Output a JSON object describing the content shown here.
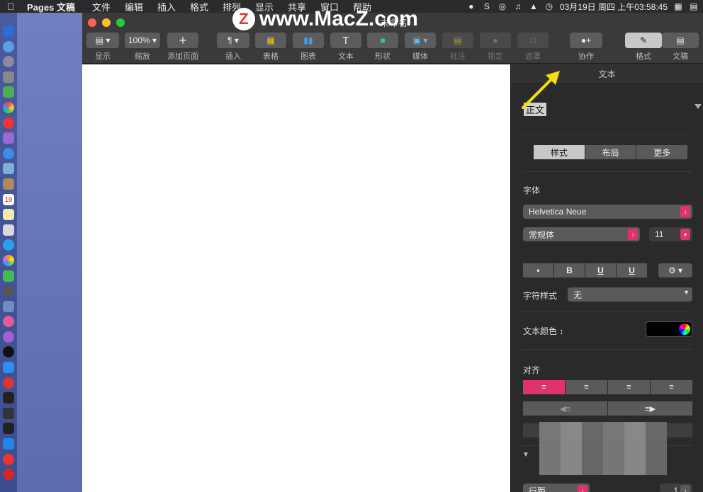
{
  "menubar": {
    "app_name": "Pages 文稿",
    "menus": [
      "文件",
      "编辑",
      "插入",
      "格式",
      "排列",
      "显示",
      "共享",
      "窗口",
      "帮助"
    ],
    "clock": "03月19日 周四 上午03:58:45"
  },
  "window": {
    "title": "未命名",
    "toolbar": {
      "view": "显示",
      "zoom_value": "100%",
      "zoom": "缩放",
      "add_page": "添加页面",
      "insert": "插入",
      "table": "表格",
      "chart": "图表",
      "text": "文本",
      "shape": "形状",
      "media": "媒体",
      "comment": "批注",
      "lock": "锁定",
      "mask": "遮罩",
      "collaborate": "协作",
      "format": "格式",
      "document": "文稿"
    }
  },
  "watermark": {
    "logo": "Z",
    "text": "www.MacZ.com"
  },
  "sidebar": {
    "header": "文本",
    "paragraph_style": "正文",
    "tabs": [
      "样式",
      "布局",
      "更多"
    ],
    "font_section": "字体",
    "font_family": "Helvetica Neue",
    "font_style": "常规体",
    "font_size": "11",
    "format_buttons": [
      "•",
      "B",
      "U",
      "U"
    ],
    "char_style_label": "字符样式",
    "char_style_value": "无",
    "text_color_label": "文本颜色",
    "text_color_value": "#000000",
    "alignment_section": "对齐",
    "line_spacing_label": "行距",
    "line_spacing_value": "1"
  }
}
